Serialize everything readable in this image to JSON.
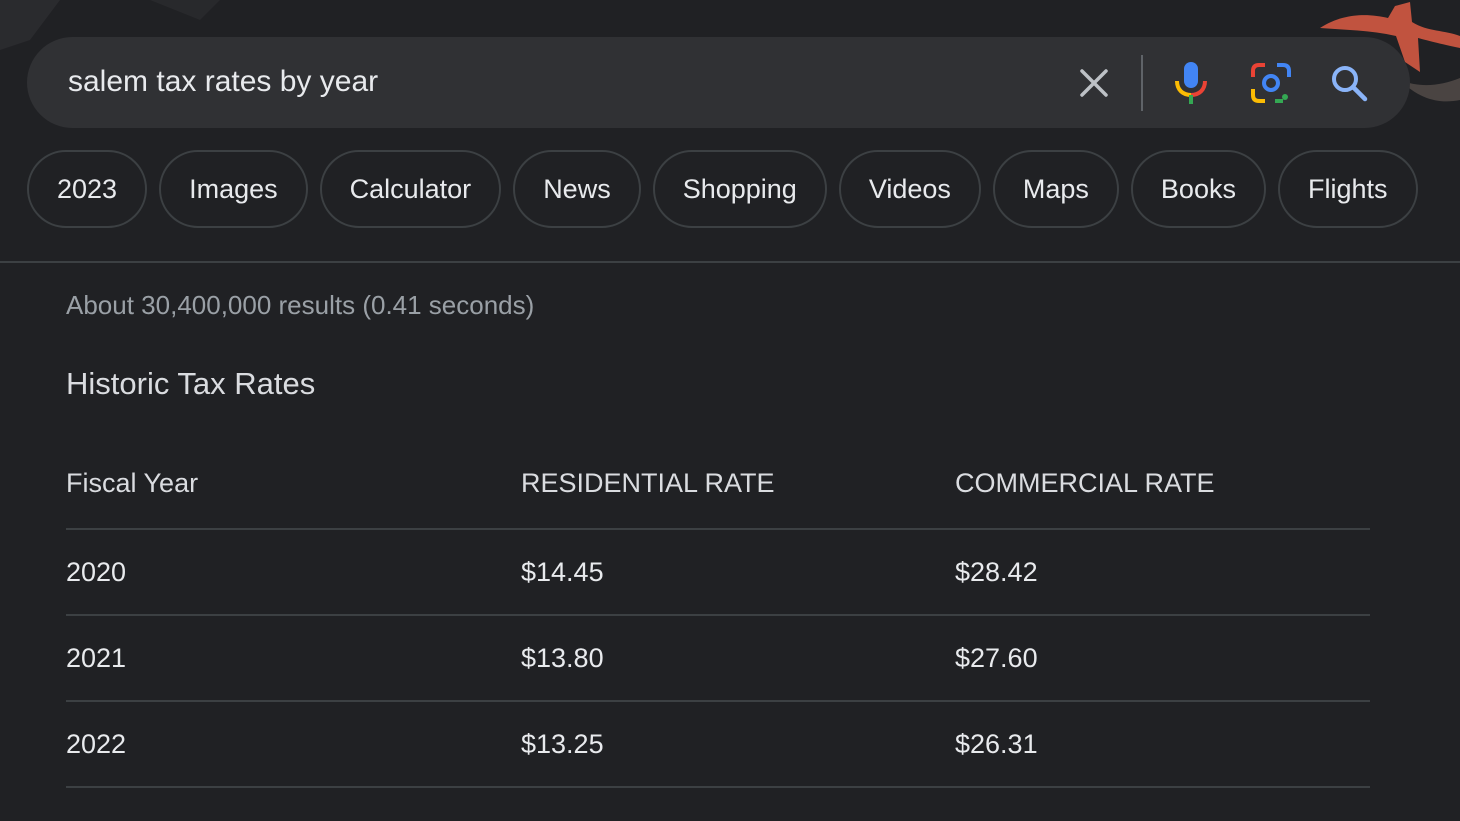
{
  "search": {
    "query": "salem tax rates by year",
    "clear_icon": "close-icon",
    "mic_icon": "microphone-icon",
    "lens_icon": "google-lens-icon",
    "search_icon": "search-icon"
  },
  "chips": [
    {
      "label": "2023"
    },
    {
      "label": "Images"
    },
    {
      "label": "Calculator"
    },
    {
      "label": "News"
    },
    {
      "label": "Shopping"
    },
    {
      "label": "Videos"
    },
    {
      "label": "Maps"
    },
    {
      "label": "Books"
    },
    {
      "label": "Flights"
    }
  ],
  "results": {
    "count_text": "About 30,400,000 results (0.41 seconds)"
  },
  "featured": {
    "title": "Historic Tax Rates",
    "headers": [
      "Fiscal Year",
      "RESIDENTIAL RATE",
      "COMMERCIAL RATE"
    ],
    "rows": [
      [
        "2020",
        "$14.45",
        "$28.42"
      ],
      [
        "2021",
        "$13.80",
        "$27.60"
      ],
      [
        "2022",
        "$13.25",
        "$26.31"
      ]
    ]
  },
  "colors": {
    "background": "#202124",
    "searchbar": "#303134",
    "text": "#e8eaed",
    "muted": "#9aa0a6",
    "border": "#3c4043",
    "google_blue": "#4285f4",
    "google_red": "#ea4335",
    "google_yellow": "#fbbc04",
    "google_green": "#34a853"
  }
}
